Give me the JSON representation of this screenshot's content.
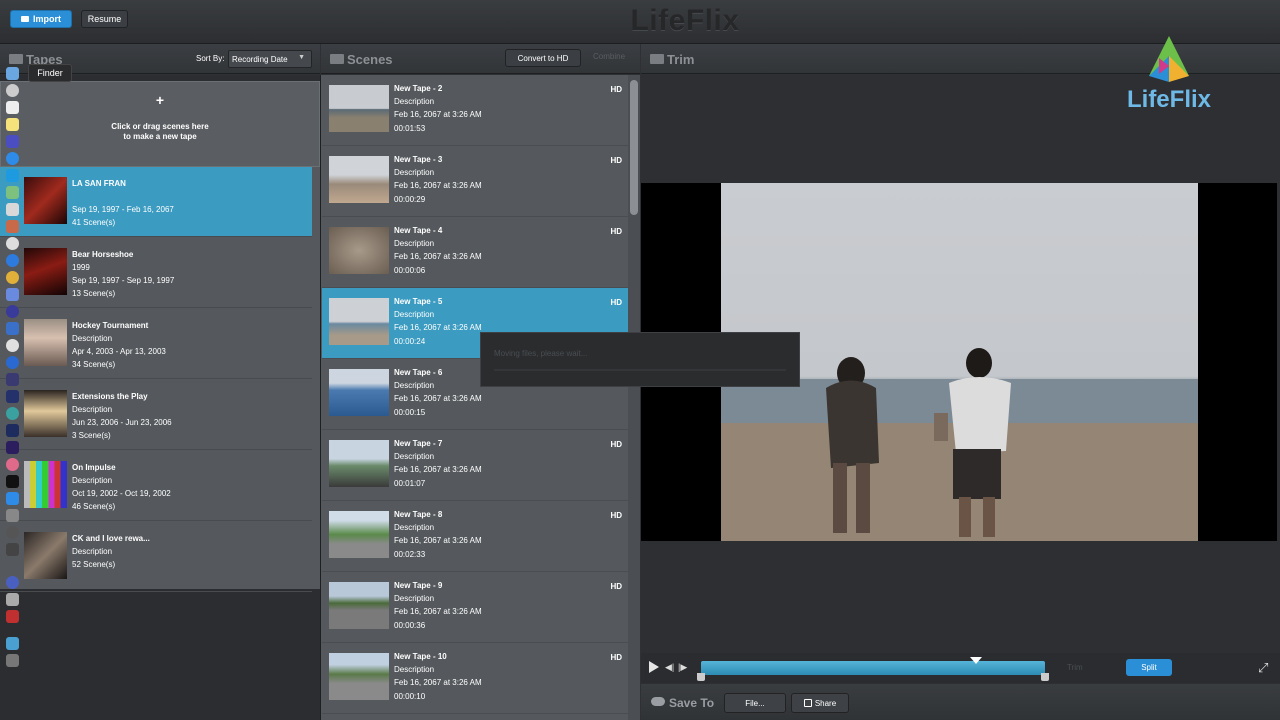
{
  "toolbar": {
    "import_label": "Import",
    "resume_label": "Resume",
    "app_title": "LifeFlix"
  },
  "tapes_panel": {
    "title": "Tapes",
    "sort_label": "Sort By:",
    "sort_value": "Recording Date",
    "new_tape_plus": "+",
    "new_tape_line1": "Click or drag scenes here",
    "new_tape_line2": "to make a new tape",
    "tapes": [
      {
        "title": "LA SAN FRAN",
        "description": "",
        "dates": "Sep 19, 1997 - Feb 16, 2067",
        "scenes": "41 Scene(s)",
        "selected": true
      },
      {
        "title": "Bear Horseshoe",
        "description": "1999",
        "dates": "Sep 19, 1997 - Sep 19, 1997",
        "scenes": "13 Scene(s)"
      },
      {
        "title": "Hockey Tournament",
        "description": "Description",
        "dates": "Apr 4, 2003 - Apr 13, 2003",
        "scenes": "34 Scene(s)"
      },
      {
        "title": "Extensions the Play",
        "description": "Description",
        "dates": "Jun 23, 2006 - Jun 23, 2006",
        "scenes": "3 Scene(s)"
      },
      {
        "title": "On Impulse",
        "description": "Description",
        "dates": "Oct 19, 2002 - Oct 19, 2002",
        "scenes": "46 Scene(s)"
      },
      {
        "title": "CK and I love rewa...",
        "description": "Description",
        "dates": "",
        "scenes": "52 Scene(s)"
      }
    ]
  },
  "dock": {
    "tooltip": "Finder"
  },
  "scenes_panel": {
    "title": "Scenes",
    "convert_label": "Convert to HD",
    "combine_label": "Combine",
    "scenes": [
      {
        "title": "New Tape - 2",
        "description": "Description",
        "date": "Feb 16, 2067 at 3:26 AM",
        "duration": "00:01:53",
        "badge": "HD"
      },
      {
        "title": "New Tape - 3",
        "description": "Description",
        "date": "Feb 16, 2067 at 3:26 AM",
        "duration": "00:00:29",
        "badge": "HD"
      },
      {
        "title": "New Tape - 4",
        "description": "Description",
        "date": "Feb 16, 2067 at 3:26 AM",
        "duration": "00:00:06",
        "badge": "HD"
      },
      {
        "title": "New Tape - 5",
        "description": "Description",
        "date": "Feb 16, 2067 at 3:26 AM",
        "duration": "00:00:24",
        "badge": "HD",
        "selected": true
      },
      {
        "title": "New Tape - 6",
        "description": "Description",
        "date": "Feb 16, 2067 at 3:26 AM",
        "duration": "00:00:15",
        "badge": ""
      },
      {
        "title": "New Tape - 7",
        "description": "Description",
        "date": "Feb 16, 2067 at 3:26 AM",
        "duration": "00:01:07",
        "badge": "HD"
      },
      {
        "title": "New Tape - 8",
        "description": "Description",
        "date": "Feb 16, 2067 at 3:26 AM",
        "duration": "00:02:33",
        "badge": "HD"
      },
      {
        "title": "New Tape - 9",
        "description": "Description",
        "date": "Feb 16, 2067 at 3:26 AM",
        "duration": "00:00:36",
        "badge": "HD"
      },
      {
        "title": "New Tape - 10",
        "description": "Description",
        "date": "Feb 16, 2067 at 3:26 AM",
        "duration": "00:00:10",
        "badge": "HD"
      }
    ]
  },
  "dialog": {
    "message": "Moving files, please wait..."
  },
  "trim_panel": {
    "title": "Trim",
    "logo_text": "LifeFlix",
    "trim_label": "Trim",
    "split_label": "Split",
    "playhead_position": 0.8
  },
  "save_bar": {
    "title": "Save To",
    "file_label": "File...",
    "share_label": "Share"
  },
  "colors": {
    "accent": "#2a8fd6",
    "selection": "#3b9bc0"
  }
}
